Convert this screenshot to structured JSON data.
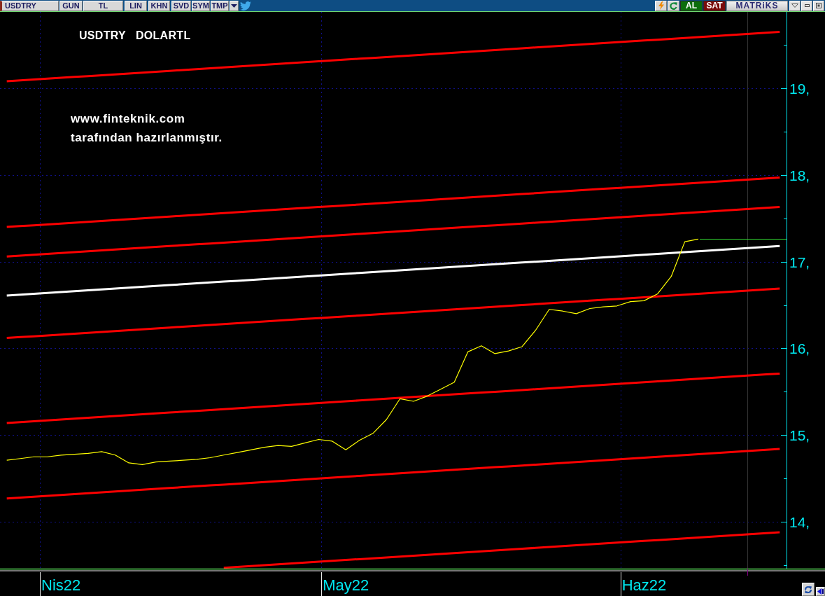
{
  "toolbar": {
    "symbol": "USDTRY",
    "buttons": [
      "GUN",
      "TL",
      "LIN",
      "KHN",
      "SVD",
      "SYM",
      "TMP"
    ],
    "trade_buttons": [
      {
        "label": "AL",
        "color": "#0b6e0b"
      },
      {
        "label": "SAT",
        "color": "#7a0a0a"
      }
    ],
    "brand": "MATRiKS"
  },
  "chart": {
    "note": "www.finteknik.com tarafından hazırlanmıştır.",
    "chart_data": {
      "type": "line",
      "title": "USDTRY   DOLARTL",
      "grid": true,
      "categories": [
        null,
        null,
        null,
        null,
        "Nis22",
        null,
        null,
        null,
        null,
        null,
        null,
        null,
        null,
        null,
        null,
        null,
        null,
        null,
        null,
        null,
        null,
        null,
        null,
        null,
        null,
        "May22",
        null,
        null,
        null,
        null,
        null,
        null,
        null,
        null,
        null,
        null,
        null,
        null,
        null,
        null,
        null,
        null,
        null,
        null,
        null,
        null,
        null,
        "Haz22",
        null,
        null,
        null,
        null,
        null,
        null,
        null,
        null,
        null,
        null
      ],
      "series": [
        {
          "color": "#ffff00",
          "values": [
            14.71,
            14.73,
            14.75,
            14.75,
            14.77,
            14.78,
            14.79,
            14.81,
            14.77,
            14.68,
            14.66,
            14.69,
            14.7,
            14.71,
            14.72,
            14.74,
            14.77,
            14.8,
            14.83,
            14.86,
            14.88,
            14.87,
            14.91,
            14.95,
            14.93,
            14.83,
            14.94,
            15.02,
            15.18,
            15.42,
            15.39,
            15.45,
            15.53,
            15.61,
            15.96,
            16.03,
            15.94,
            15.97,
            16.02,
            16.21,
            16.45,
            16.43,
            16.4,
            16.46,
            16.48,
            16.49,
            16.54,
            16.55,
            16.63,
            16.83,
            17.23,
            17.26,
            null,
            null,
            null,
            null,
            null,
            null
          ]
        },
        {
          "color": "#ff0000",
          "values": [
            19.08,
            19.09,
            19.1,
            19.11,
            19.12,
            19.13,
            19.14,
            19.15,
            19.16,
            19.17,
            19.18,
            19.19,
            19.2,
            19.21,
            19.22,
            19.23,
            19.24,
            19.25,
            19.26,
            19.27,
            19.28,
            19.29,
            19.3,
            19.31,
            19.32,
            19.33,
            19.34,
            19.35,
            19.36,
            19.37,
            19.38,
            19.39,
            19.4,
            19.41,
            19.42,
            19.43,
            19.44,
            19.45,
            19.46,
            19.47,
            19.48,
            19.49,
            19.5,
            19.51,
            19.52,
            19.53,
            19.54,
            19.55,
            19.56,
            19.57,
            19.58,
            19.59,
            19.6,
            19.61,
            19.62,
            19.63,
            19.64,
            19.65
          ]
        },
        {
          "color": "#ff0000",
          "values": [
            17.4,
            17.41,
            17.42,
            17.43,
            17.44,
            17.45,
            17.46,
            17.47,
            17.48,
            17.49,
            17.5,
            17.51,
            17.52,
            17.53,
            17.54,
            17.55,
            17.56,
            17.57,
            17.58,
            17.59,
            17.6,
            17.61,
            17.62,
            17.63,
            17.64,
            17.65,
            17.66,
            17.67,
            17.68,
            17.69,
            17.7,
            17.71,
            17.72,
            17.73,
            17.74,
            17.75,
            17.76,
            17.77,
            17.78,
            17.79,
            17.8,
            17.81,
            17.82,
            17.83,
            17.84,
            17.85,
            17.86,
            17.87,
            17.88,
            17.89,
            17.9,
            17.91,
            17.92,
            17.93,
            17.94,
            17.95,
            17.96,
            17.97
          ]
        },
        {
          "color": "#ff0000",
          "values": [
            17.06,
            17.07,
            17.08,
            17.09,
            17.1,
            17.11,
            17.12,
            17.13,
            17.14,
            17.15,
            17.16,
            17.17,
            17.18,
            17.19,
            17.2,
            17.21,
            17.22,
            17.23,
            17.24,
            17.25,
            17.26,
            17.27,
            17.28,
            17.29,
            17.3,
            17.31,
            17.32,
            17.33,
            17.34,
            17.35,
            17.36,
            17.37,
            17.38,
            17.39,
            17.4,
            17.41,
            17.42,
            17.43,
            17.44,
            17.45,
            17.46,
            17.47,
            17.48,
            17.49,
            17.5,
            17.51,
            17.52,
            17.53,
            17.54,
            17.55,
            17.56,
            17.57,
            17.58,
            17.59,
            17.6,
            17.61,
            17.62,
            17.63
          ]
        },
        {
          "color": "#ffffff",
          "values": [
            16.61,
            16.62,
            16.63,
            16.64,
            16.65,
            16.66,
            16.67,
            16.68,
            16.69,
            16.7,
            16.71,
            16.72,
            16.73,
            16.74,
            16.75,
            16.76,
            16.77,
            16.78,
            16.79,
            16.8,
            16.81,
            16.82,
            16.83,
            16.84,
            16.85,
            16.86,
            16.87,
            16.88,
            16.89,
            16.9,
            16.91,
            16.92,
            16.93,
            16.94,
            16.95,
            16.96,
            16.97,
            16.98,
            16.99,
            17.0,
            17.01,
            17.02,
            17.03,
            17.04,
            17.05,
            17.06,
            17.07,
            17.08,
            17.09,
            17.1,
            17.11,
            17.12,
            17.13,
            17.14,
            17.15,
            17.16,
            17.17,
            17.18
          ]
        },
        {
          "color": "#ff0000",
          "values": [
            16.12,
            16.13,
            16.14,
            16.15,
            16.16,
            16.17,
            16.18,
            16.19,
            16.2,
            16.21,
            16.22,
            16.23,
            16.24,
            16.25,
            16.26,
            16.27,
            16.28,
            16.29,
            16.3,
            16.31,
            16.32,
            16.33,
            16.34,
            16.35,
            16.36,
            16.37,
            16.38,
            16.39,
            16.4,
            16.41,
            16.42,
            16.43,
            16.44,
            16.45,
            16.46,
            16.47,
            16.48,
            16.49,
            16.5,
            16.51,
            16.52,
            16.53,
            16.54,
            16.55,
            16.56,
            16.57,
            16.58,
            16.59,
            16.6,
            16.61,
            16.62,
            16.63,
            16.64,
            16.65,
            16.66,
            16.67,
            16.68,
            16.69
          ]
        },
        {
          "color": "#ff0000",
          "values": [
            15.14,
            15.15,
            15.16,
            15.17,
            15.18,
            15.19,
            15.2,
            15.21,
            15.22,
            15.23,
            15.24,
            15.25,
            15.26,
            15.27,
            15.28,
            15.29,
            15.3,
            15.31,
            15.32,
            15.33,
            15.34,
            15.35,
            15.36,
            15.37,
            15.38,
            15.39,
            15.4,
            15.41,
            15.42,
            15.43,
            15.44,
            15.45,
            15.46,
            15.47,
            15.48,
            15.49,
            15.5,
            15.51,
            15.52,
            15.53,
            15.54,
            15.55,
            15.56,
            15.57,
            15.58,
            15.59,
            15.6,
            15.61,
            15.62,
            15.63,
            15.64,
            15.65,
            15.66,
            15.67,
            15.68,
            15.69,
            15.7,
            15.71
          ]
        },
        {
          "color": "#ff0000",
          "values": [
            14.27,
            14.28,
            14.29,
            14.3,
            14.31,
            14.32,
            14.33,
            14.34,
            14.35,
            14.36,
            14.37,
            14.38,
            14.39,
            14.4,
            14.41,
            14.42,
            14.43,
            14.44,
            14.45,
            14.46,
            14.47,
            14.48,
            14.49,
            14.5,
            14.51,
            14.52,
            14.53,
            14.54,
            14.55,
            14.56,
            14.57,
            14.58,
            14.59,
            14.6,
            14.61,
            14.62,
            14.63,
            14.64,
            14.65,
            14.66,
            14.67,
            14.68,
            14.69,
            14.7,
            14.71,
            14.72,
            14.73,
            14.74,
            14.75,
            14.76,
            14.77,
            14.78,
            14.79,
            14.8,
            14.81,
            14.82,
            14.83,
            14.84
          ]
        },
        {
          "color": "#ff0000",
          "values": [
            null,
            null,
            null,
            null,
            null,
            null,
            null,
            null,
            null,
            null,
            null,
            null,
            null,
            null,
            null,
            null,
            13.47,
            13.48,
            13.49,
            13.5,
            13.51,
            13.52,
            13.53,
            13.54,
            13.55,
            13.56,
            13.57,
            13.58,
            13.59,
            13.6,
            13.61,
            13.62,
            13.63,
            13.64,
            13.65,
            13.66,
            13.67,
            13.68,
            13.69,
            13.7,
            13.71,
            13.72,
            13.73,
            13.74,
            13.75,
            13.76,
            13.77,
            13.78,
            13.79,
            13.8,
            13.81,
            13.82,
            13.83,
            13.84,
            13.85,
            13.86,
            13.87,
            13.88
          ]
        }
      ],
      "ref_lines": [
        {
          "axis": "y",
          "value": 17.26,
          "color": "#33dd33"
        }
      ],
      "ylim": [
        13.46,
        19.88
      ],
      "yticks": [
        {
          "value": 14,
          "label": "14,"
        },
        {
          "value": 15,
          "label": "15,"
        },
        {
          "value": 16,
          "label": "16,"
        },
        {
          "value": 17,
          "label": "17,"
        },
        {
          "value": 18,
          "label": "18,"
        },
        {
          "value": 19,
          "label": "19,"
        }
      ]
    }
  }
}
